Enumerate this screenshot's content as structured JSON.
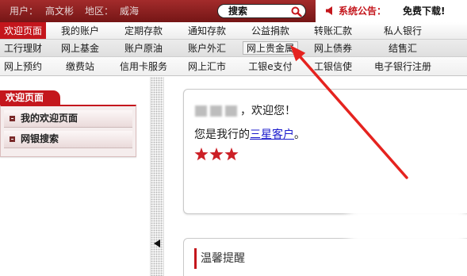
{
  "header": {
    "user_label": "用户：",
    "user_name": "高文彬",
    "region_label": "地区：",
    "region_name": "威海",
    "search_label": "搜索",
    "notice_label": "系统公告：",
    "notice_text": "免费下载!"
  },
  "nav": {
    "rows": [
      [
        {
          "label": "欢迎页面",
          "selected": true
        },
        {
          "label": "我的账户"
        },
        {
          "label": "定期存款"
        },
        {
          "label": "通知存款"
        },
        {
          "label": "公益捐款"
        },
        {
          "label": "转账汇款"
        },
        {
          "label": "私人银行"
        }
      ],
      [
        {
          "label": "工行理财"
        },
        {
          "label": "网上基金"
        },
        {
          "label": "账户原油"
        },
        {
          "label": "账户外汇"
        },
        {
          "label": "网上贵金属",
          "highlighted": true
        },
        {
          "label": "网上债券"
        },
        {
          "label": "结售汇"
        }
      ],
      [
        {
          "label": "网上预约"
        },
        {
          "label": "缴费站"
        },
        {
          "label": "信用卡服务"
        },
        {
          "label": "网上汇市"
        },
        {
          "label": "工银e支付"
        },
        {
          "label": "工银信使"
        },
        {
          "label": "电子银行注册"
        }
      ]
    ]
  },
  "sidebar": {
    "title": "欢迎页面",
    "items": [
      {
        "label": "我的欢迎页面"
      },
      {
        "label": "网银搜索"
      }
    ]
  },
  "welcome": {
    "greeting": "，欢迎您！",
    "level_prefix": "您是我行的",
    "level_link": "三星客户",
    "level_suffix": "。",
    "star_count": 3
  },
  "reminder": {
    "title": "温馨提醒"
  },
  "icons": {
    "search": "search-icon",
    "notice": "speaker-icon",
    "collapse": "collapse-left-icon",
    "rating": "star-icon",
    "menu_bullet": "bullet-icon"
  },
  "colors": {
    "brand_red": "#c4161c",
    "header_top": "#a32b2b",
    "header_bottom": "#751616",
    "link_blue": "#1a1acc",
    "star_red": "#cc1f26",
    "annotation_arrow": "#e5231f"
  }
}
